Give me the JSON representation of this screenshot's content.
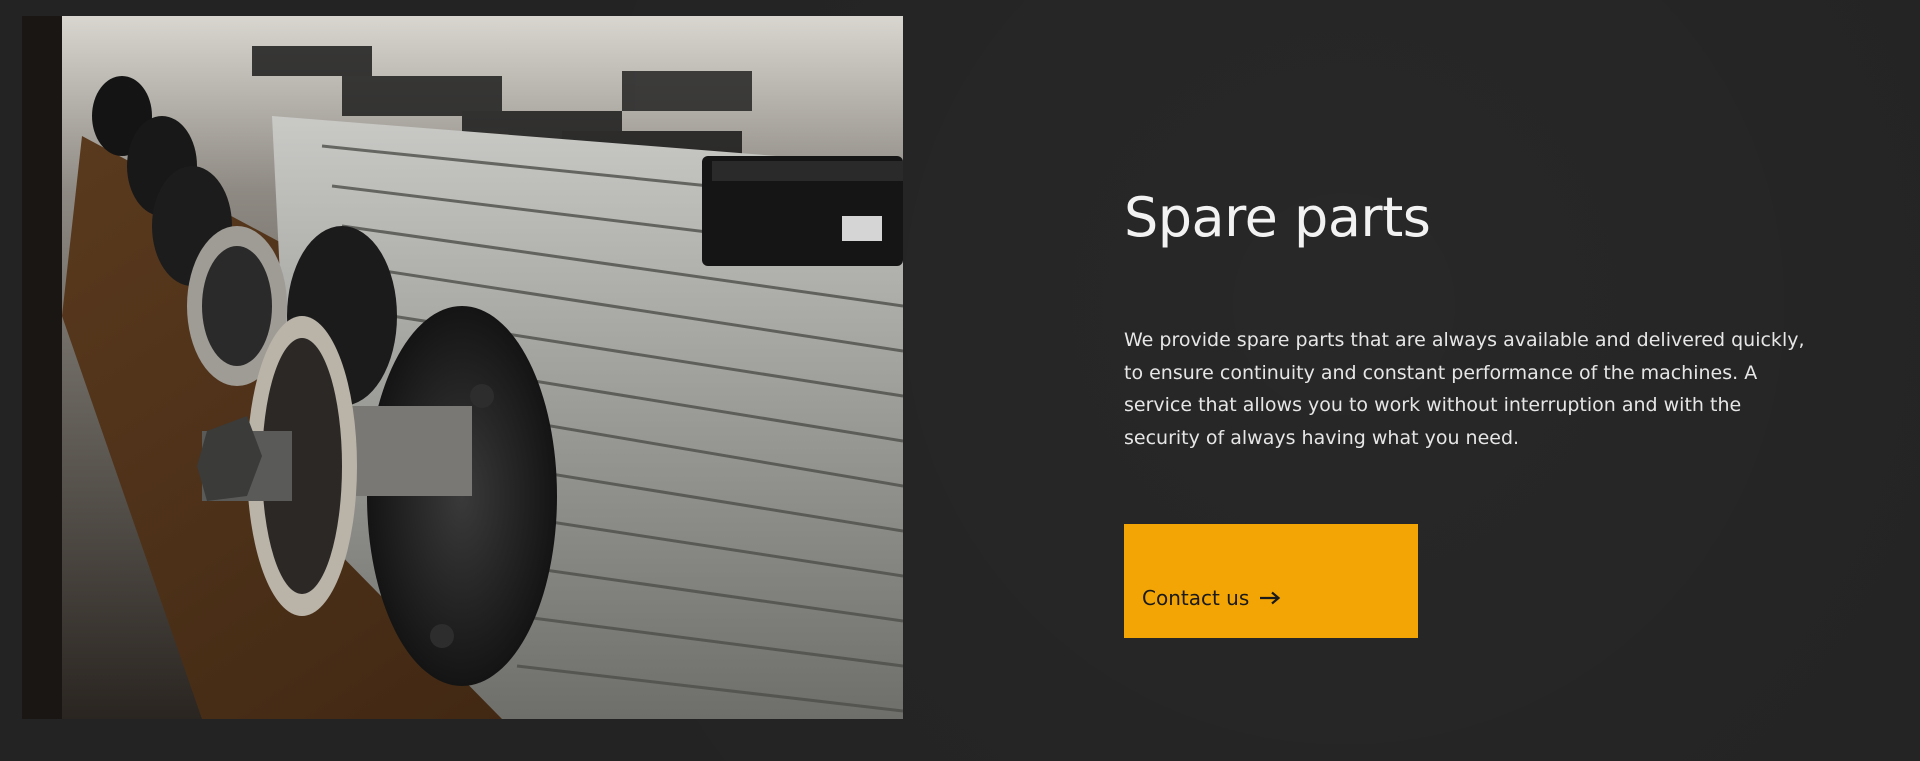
{
  "section": {
    "title": "Spare parts",
    "description_lines": [
      "We provide spare parts that are always available and delivered quickly,",
      "to ensure continuity and constant performance of the machines. A",
      "service that allows you to work without interruption and with the",
      "security of always having what you need."
    ],
    "cta": {
      "label": "Contact us",
      "icon": "arrow-right-icon"
    }
  },
  "photo": {
    "subject": "row of electric motors on wooden workbench",
    "icon": "machine-photo"
  },
  "colors": {
    "background": "#232323",
    "accent": "#f2a505",
    "title_text": "#f2f2f2",
    "body_text": "#e6e6e6",
    "button_text": "#1a1a1a"
  }
}
